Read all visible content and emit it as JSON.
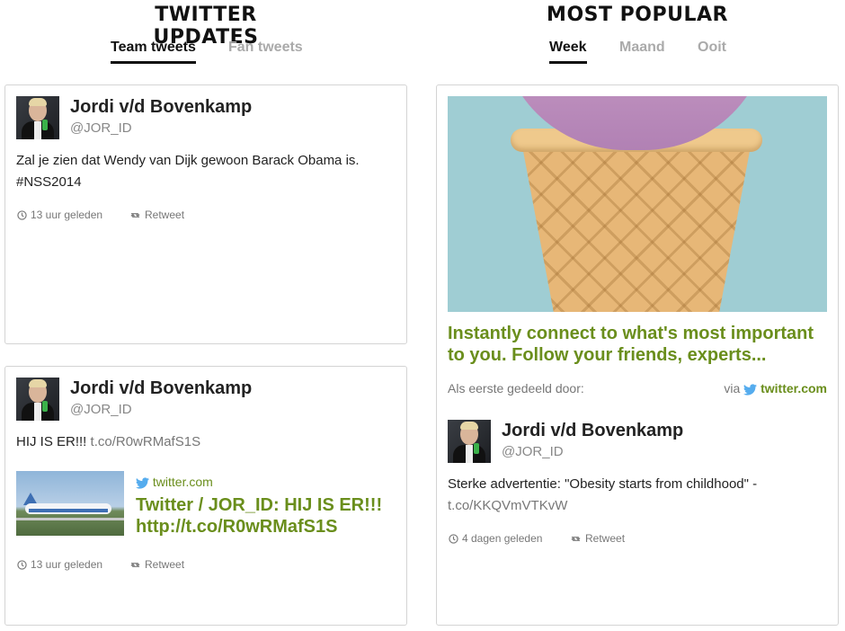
{
  "left": {
    "title": "TWITTER UPDATES",
    "tabs": [
      {
        "label": "Team tweets",
        "active": true
      },
      {
        "label": "Fan tweets",
        "active": false
      }
    ],
    "tweets": [
      {
        "name": "Jordi v/d Bovenkamp",
        "handle": "@JOR_ID",
        "text_line1": "Zal je zien dat Wendy van Dijk gewoon Barack Obama is.",
        "text_line2": "#NSS2014",
        "time": "13 uur geleden",
        "retweet": "Retweet"
      },
      {
        "name": "Jordi v/d Bovenkamp",
        "handle": "@JOR_ID",
        "text": "HIJ IS ER!!!",
        "link": "t.co/R0wRMafS1S",
        "preview_source": "twitter.com",
        "preview_title_line1": "Twitter / JOR_ID: HIJ IS ER!!!",
        "preview_title_line2": "http://t.co/R0wRMafS1S",
        "time": "13 uur geleden",
        "retweet": "Retweet"
      }
    ]
  },
  "right": {
    "title": "MOST POPULAR",
    "tabs": [
      {
        "label": "Week",
        "active": true
      },
      {
        "label": "Maand",
        "active": false
      },
      {
        "label": "Ooit",
        "active": false
      }
    ],
    "feature": {
      "headline_line1": "Instantly connect to what's most important",
      "headline_line2": "to you. Follow your friends, experts...",
      "shared_by": "Als eerste gedeeld door:",
      "via": "via",
      "source": "twitter.com"
    },
    "tweet": {
      "name": "Jordi v/d Bovenkamp",
      "handle": "@JOR_ID",
      "text": "Sterke advertentie: \"Obesity starts from childhood\" -",
      "link": "t.co/KKQVmVTKvW",
      "time": "4 dagen geleden",
      "retweet": "Retweet"
    }
  },
  "colors": {
    "accent_green": "#6a8e1c",
    "twitter_blue": "#55acee"
  },
  "icons": [
    "clock-icon",
    "retweet-icon",
    "twitter-bird-icon"
  ]
}
